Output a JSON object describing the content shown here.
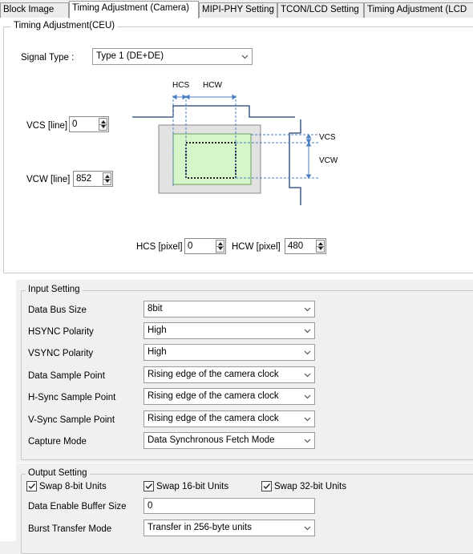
{
  "tabs": [
    {
      "label": "Block Image",
      "active": false
    },
    {
      "label": "Timing Adjustment (Camera)",
      "active": true
    },
    {
      "label": "MIPI-PHY Setting",
      "active": false
    },
    {
      "label": "TCON/LCD Setting",
      "active": false
    },
    {
      "label": "Timing Adjustment (LCD",
      "active": false
    }
  ],
  "timing_group": {
    "title": "Timing Adjustment(CEU)",
    "signal_type_label": "Signal Type :",
    "signal_type_value": "Type 1 (DE+DE)",
    "vcs_label": "VCS [line]",
    "vcs_value": "0",
    "vcw_label": "VCW [line]",
    "vcw_value": "852",
    "hcs_label": "HCS [pixel]",
    "hcs_value": "0",
    "hcw_label": "HCW [pixel]",
    "hcw_value": "480",
    "diagram_labels": {
      "hcs": "HCS",
      "hcw": "HCW",
      "vcs": "VCS",
      "vcw": "VCW"
    }
  },
  "input_group": {
    "title": "Input Setting",
    "rows": [
      {
        "label": "Data Bus Size",
        "value": "8bit"
      },
      {
        "label": "HSYNC Polarity",
        "value": "High"
      },
      {
        "label": "VSYNC Polarity",
        "value": "High"
      },
      {
        "label": "Data Sample Point",
        "value": "Rising edge of the camera clock"
      },
      {
        "label": "H-Sync Sample Point",
        "value": "Rising edge of the camera clock"
      },
      {
        "label": "V-Sync Sample Point",
        "value": "Rising edge of the camera clock"
      },
      {
        "label": "Capture Mode",
        "value": "Data Synchronous Fetch Mode"
      }
    ]
  },
  "output_group": {
    "title": "Output Setting",
    "checkboxes": [
      {
        "label": "Swap 8-bit Units",
        "checked": true
      },
      {
        "label": "Swap 16-bit Units",
        "checked": true
      },
      {
        "label": "Swap 32-bit Units",
        "checked": true
      }
    ],
    "buffer_size_label": "Data Enable Buffer Size",
    "buffer_size_value": "0",
    "burst_label": "Burst Transfer Mode",
    "burst_value": "Transfer in 256-byte units"
  },
  "colors": {
    "panel_bg": "#ffffff",
    "window_bg": "#f0f0f0",
    "diagram_green": "#d6f5c8",
    "diagram_blue_dash": "#4a7fc1"
  }
}
